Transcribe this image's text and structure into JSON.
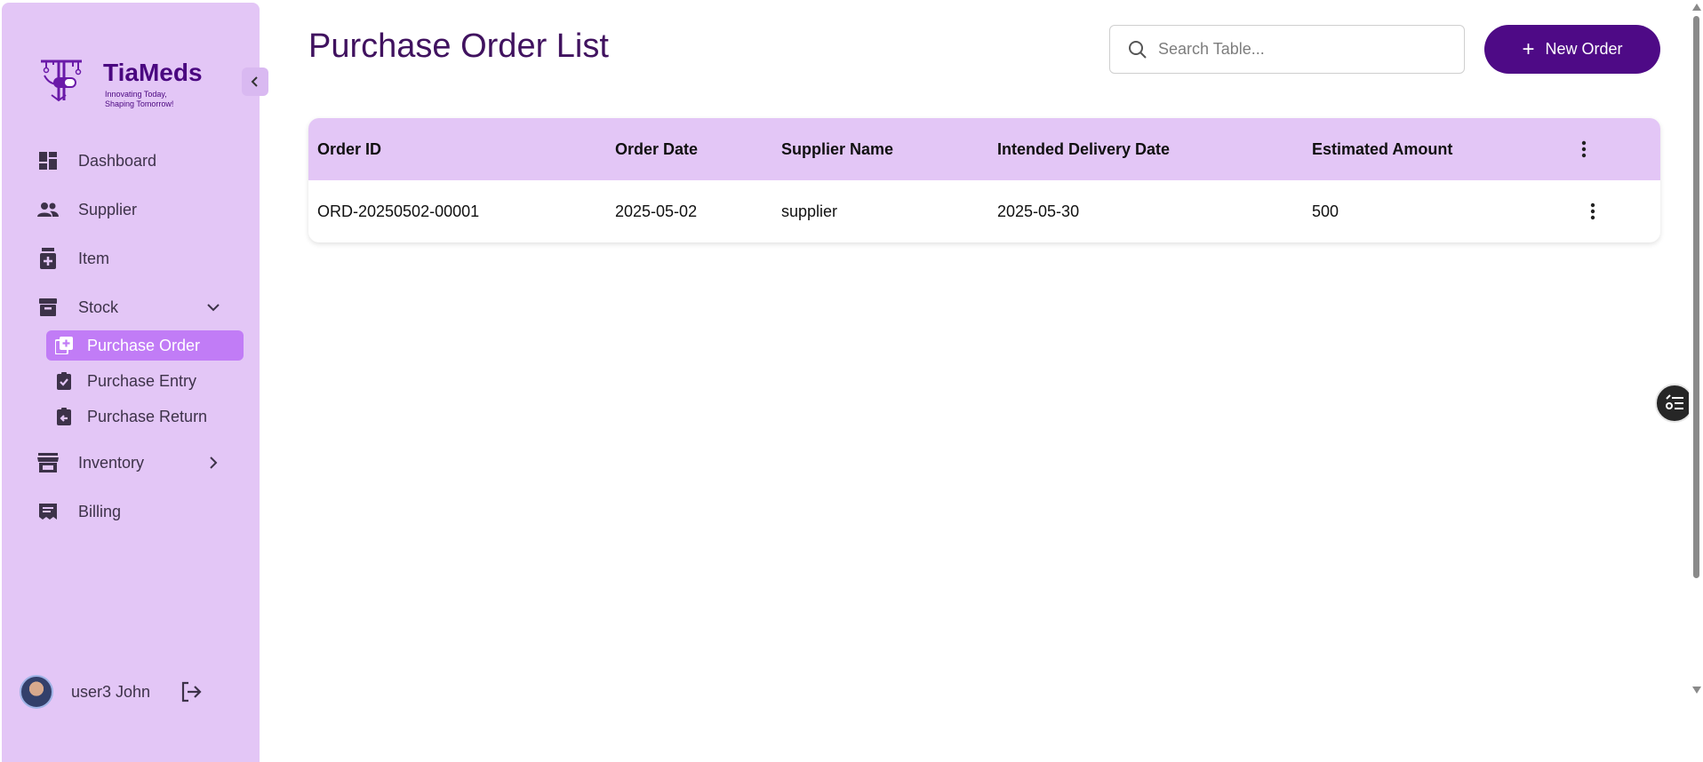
{
  "brand": {
    "name": "TiaMeds",
    "tagline_line1": "Innovating Today,",
    "tagline_line2": "Shaping Tomorrow!"
  },
  "sidebar": {
    "items": [
      {
        "label": "Dashboard",
        "icon": "dashboard-icon"
      },
      {
        "label": "Supplier",
        "icon": "people-icon"
      },
      {
        "label": "Item",
        "icon": "medicine-bottle-icon"
      },
      {
        "label": "Stock",
        "icon": "archive-box-icon"
      },
      {
        "label": "Inventory",
        "icon": "store-icon"
      },
      {
        "label": "Billing",
        "icon": "receipt-icon"
      }
    ],
    "stock_subitems": [
      {
        "label": "Purchase Order",
        "icon": "add-to-queue-icon",
        "active": true
      },
      {
        "label": "Purchase Entry",
        "icon": "clipboard-check-icon",
        "active": false
      },
      {
        "label": "Purchase Return",
        "icon": "clipboard-return-icon",
        "active": false
      }
    ]
  },
  "user": {
    "name": "user3 John"
  },
  "page": {
    "title": "Purchase Order List"
  },
  "search": {
    "placeholder": "Search Table...",
    "value": ""
  },
  "toolbar": {
    "new_order_label": "New Order"
  },
  "table": {
    "columns": [
      "Order ID",
      "Order Date",
      "Supplier Name",
      "Intended Delivery Date",
      "Estimated Amount"
    ],
    "rows": [
      [
        "ORD-20250502-00001",
        "2025-05-02",
        "supplier",
        "2025-05-30",
        "500"
      ]
    ]
  },
  "colors": {
    "sidebar_bg": "#e3c6f6",
    "accent": "#4e0a86",
    "active_item": "#c17cf6",
    "title": "#40125f"
  }
}
